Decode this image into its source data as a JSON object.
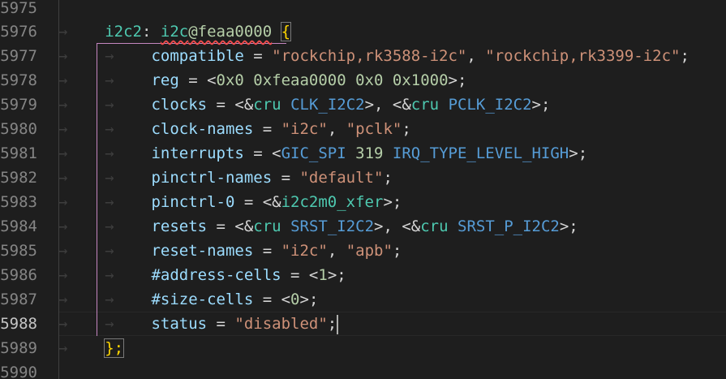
{
  "editor": {
    "line_numbers": [
      "5975",
      "5976",
      "5977",
      "5978",
      "5979",
      "5980",
      "5981",
      "5982",
      "5983",
      "5984",
      "5985",
      "5986",
      "5987",
      "5988",
      "5989",
      "5990"
    ],
    "active_line": "5988",
    "colors": {
      "background": "#1e1e1e",
      "property": "#9cdcfe",
      "string": "#ce9178",
      "label": "#4ec9b0",
      "constant": "#569cd6",
      "number": "#b5cea8",
      "brace": "#ffd700",
      "guide_active": "#c586c0",
      "error_squiggle": "#f14c4c"
    },
    "node": {
      "label": "i2c2",
      "name": "i2c",
      "address": "@feaa0000",
      "open_brace": "{",
      "close": "};"
    },
    "props": {
      "compatible": {
        "key": "compatible",
        "v1": "\"rockchip,rk3588-i2c\"",
        "v2": "\"rockchip,rk3399-i2c\""
      },
      "reg": {
        "key": "reg",
        "value": "0x0 0xfeaa0000 0x0 0x1000"
      },
      "clocks": {
        "key": "clocks",
        "ref": "cru",
        "c1": "CLK_I2C2",
        "c2": "PCLK_I2C2"
      },
      "clock_names": {
        "key": "clock-names",
        "v1": "\"i2c\"",
        "v2": "\"pclk\""
      },
      "interrupts": {
        "key": "interrupts",
        "c1": "GIC_SPI",
        "num": "319",
        "c2": "IRQ_TYPE_LEVEL_HIGH"
      },
      "pinctrl_names": {
        "key": "pinctrl-names",
        "v1": "\"default\""
      },
      "pinctrl_0": {
        "key": "pinctrl-0",
        "ref": "i2c2m0_xfer"
      },
      "resets": {
        "key": "resets",
        "ref": "cru",
        "c1": "SRST_I2C2",
        "c2": "SRST_P_I2C2"
      },
      "reset_names": {
        "key": "reset-names",
        "v1": "\"i2c\"",
        "v2": "\"apb\""
      },
      "address_cells": {
        "key": "#address-cells",
        "value": "1"
      },
      "size_cells": {
        "key": "#size-cells",
        "value": "0"
      },
      "status": {
        "key": "status",
        "value": "\"disabled\""
      }
    }
  }
}
